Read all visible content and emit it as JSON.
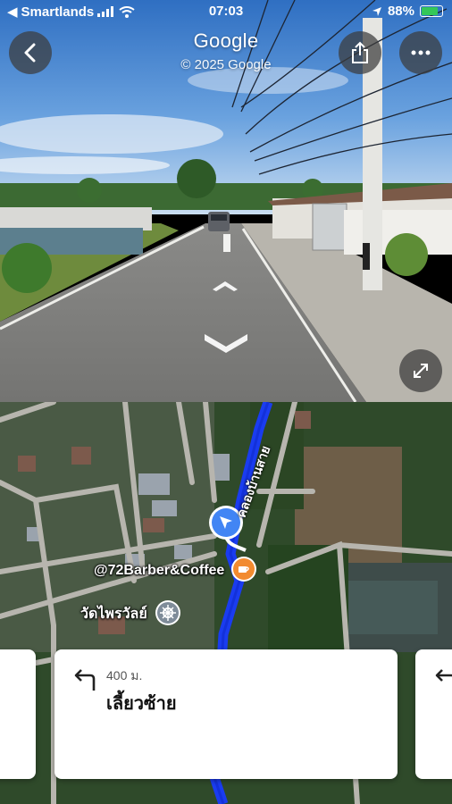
{
  "status": {
    "carrier": "Smartlands",
    "time": "07:03",
    "battery_percent": "88%",
    "battery_level": 0.88
  },
  "street_view": {
    "title": "Google",
    "copyright": "© 2025 Google"
  },
  "map": {
    "poi_barber": "@72Barber&Coffee",
    "poi_temple": "วัดไพรวัลย์",
    "road_label": "คลองบ้านสาย"
  },
  "directions": {
    "current": {
      "distance": "400 ม.",
      "instruction": "เลี้ยวซ้าย",
      "icon": "turn-left-icon"
    },
    "next": {
      "icon": "turn-left-icon"
    }
  },
  "colors": {
    "route": "#1a3cf0",
    "location_marker": "#4285f4",
    "cafe_marker": "#f28b30"
  }
}
